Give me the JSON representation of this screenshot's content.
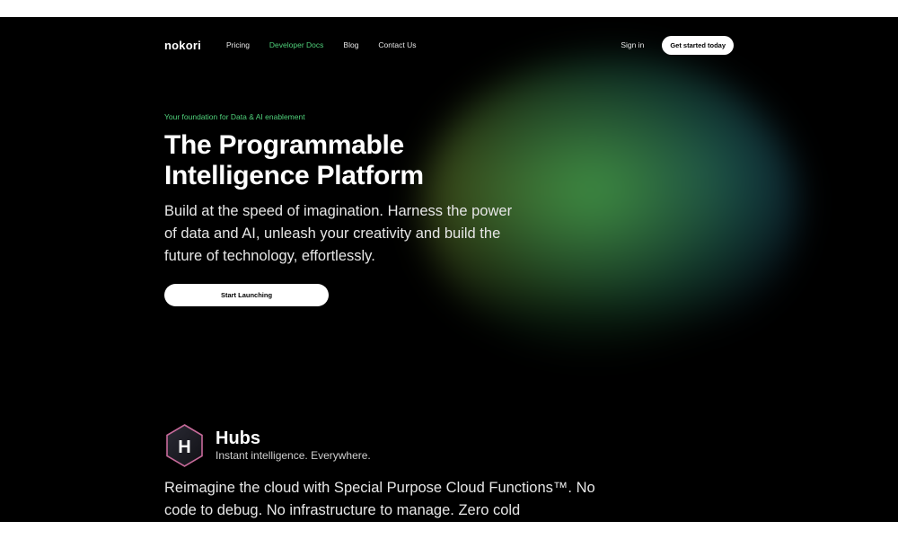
{
  "nav": {
    "logo": "nokori",
    "links": [
      "Pricing",
      "Developer Docs",
      "Blog",
      "Contact Us"
    ],
    "active_link": "Developer Docs",
    "sign_in": "Sign in",
    "cta": "Get started today"
  },
  "hero": {
    "eyebrow": "Your foundation for Data & AI enablement",
    "title_line1": "The Programmable",
    "title_line2": "Intelligence Platform",
    "subtitle": "Build at the speed of imagination. Harness the power of data and AI, unleash your creativity and build the future of technology, effortlessly.",
    "button": "Start Launching"
  },
  "hubs": {
    "icon_letter": "H",
    "title": "Hubs",
    "tagline": "Instant intelligence. Everywhere.",
    "body": "Reimagine the cloud with Special Purpose Cloud Functions™. No code to debug. No infrastructure to manage. Zero cold"
  },
  "colors": {
    "accent_green": "#4fd07a",
    "background": "#000000",
    "hubs_border": "#c76a9a"
  }
}
